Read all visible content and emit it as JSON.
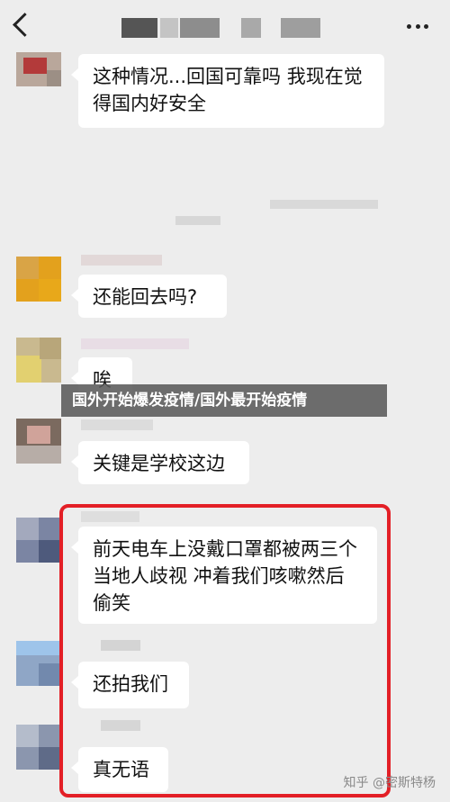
{
  "header": {
    "back_icon": "chevron-left-icon",
    "more_icon": "more-dots-icon"
  },
  "messages": [
    {
      "text": "这种情况...回国可靠吗  我现在觉得国内好安全"
    },
    {
      "text": "还能回去吗?"
    },
    {
      "text": "唉"
    },
    {
      "text": "关键是学校这边"
    },
    {
      "text": "前天电车上没戴口罩都被两三个当地人歧视 冲着我们咳嗽然后偷笑"
    },
    {
      "text": "还拍我们"
    },
    {
      "text": "真无语"
    }
  ],
  "banner": {
    "text": "国外开始爆发疫情/国外最开始疫情"
  },
  "watermark": {
    "text": "知乎 @密斯特杨"
  },
  "colors": {
    "highlight_border": "#e31f26",
    "bubble": "#ffffff",
    "background": "#ededed"
  }
}
